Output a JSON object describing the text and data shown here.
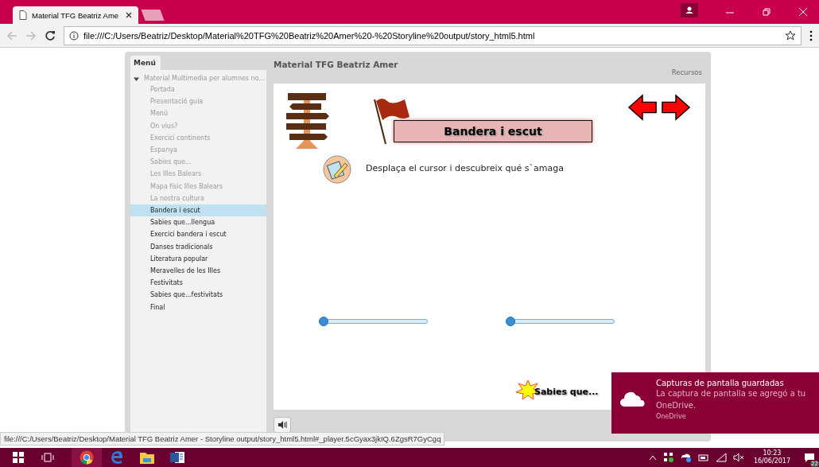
{
  "browser": {
    "tab_title": "Material TFG Beatriz Ame",
    "url": "file:///C:/Users/Beatriz/Desktop/Material%20TFG%20Beatriz%20Amer%20-%20Storyline%20output/story_html5.html",
    "status_url": "file:///C:/Users/Beatriz/Desktop/Material TFG Beatriz Amer - Storyline output/story_html5.html#_player.5cGyax3jkIQ.6ZgsR7GyCgq"
  },
  "player": {
    "title": "Material TFG Beatriz Amer",
    "resources_label": "Recursos",
    "menu_tab": "Menú",
    "menu": {
      "label": "Material Multimedia per alumnes no...",
      "expanded": true,
      "children": [
        {
          "label": "Portada",
          "visited": true,
          "selected": false
        },
        {
          "label": "Presentació guia",
          "visited": true,
          "selected": false
        },
        {
          "label": "Menú",
          "visited": true,
          "selected": false
        },
        {
          "label": "On vius?",
          "visited": true,
          "selected": false
        },
        {
          "label": "Exercici continents",
          "visited": true,
          "selected": false
        },
        {
          "label": "Espanya",
          "visited": true,
          "selected": false
        },
        {
          "label": "Sabies que...",
          "visited": true,
          "selected": false
        },
        {
          "label": "Les Illes Balears",
          "visited": true,
          "selected": false
        },
        {
          "label": "Mapa físic Illes Balears",
          "visited": true,
          "selected": false
        },
        {
          "label": "La nostra cultura",
          "visited": true,
          "selected": false
        },
        {
          "label": "Bandera i escut",
          "visited": false,
          "selected": true
        },
        {
          "label": "Sabies que...llengua",
          "visited": false,
          "selected": false
        },
        {
          "label": "Exercici bandera i escut",
          "visited": false,
          "selected": false
        },
        {
          "label": "Danses tradicionals",
          "visited": false,
          "selected": false
        },
        {
          "label": "Literatura popular",
          "visited": false,
          "selected": false
        },
        {
          "label": "Meravelles de les Illes",
          "visited": false,
          "selected": false
        },
        {
          "label": "Festivitats",
          "visited": false,
          "selected": false
        },
        {
          "label": "Sabies que...festivitats",
          "visited": false,
          "selected": false
        },
        {
          "label": "Final",
          "visited": false,
          "selected": false
        }
      ]
    },
    "slide": {
      "heading": "Bandera i escut",
      "instruction": "Desplaça el cursor i descubreix qué s`amaga",
      "sliders": [
        {
          "level": 0
        },
        {
          "level": 0
        }
      ],
      "callout": "Sabies que..."
    }
  },
  "toast": {
    "title": "Capturas de pantalla guardadas",
    "message": "La captura de pantalla se agregó a tu OneDrive.",
    "source": "OneDrive"
  },
  "taskbar": {
    "time": "10:23",
    "date": "16/06/2017",
    "notifications": "22"
  }
}
